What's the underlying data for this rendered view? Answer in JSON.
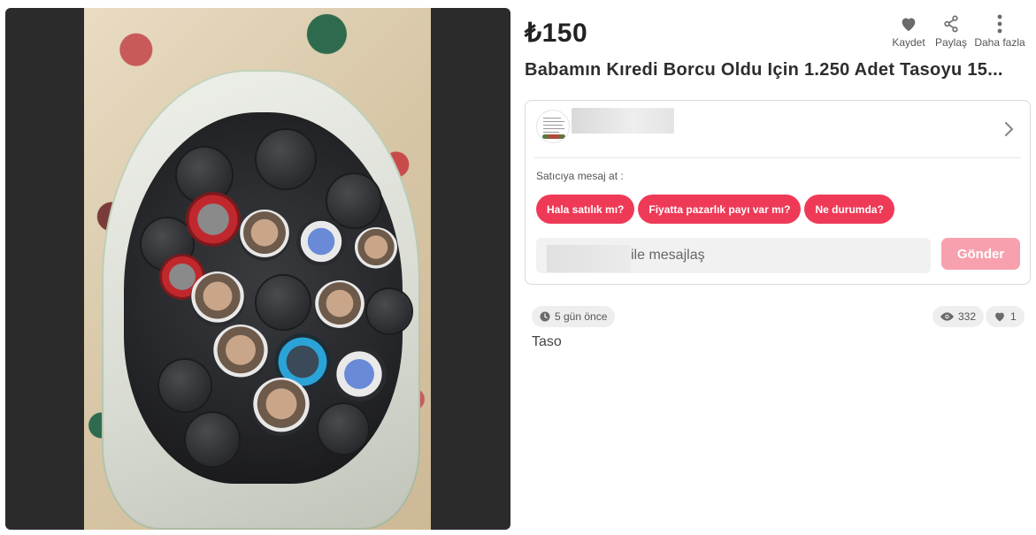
{
  "listing": {
    "price": "₺150",
    "title": "Babamın Kıredi Borcu Oldu Için 1.250 Adet Tasoyu 15...",
    "category": "Taso"
  },
  "actions": [
    {
      "label": "Kaydet",
      "icon": "heart-icon"
    },
    {
      "label": "Paylaş",
      "icon": "share-icon"
    },
    {
      "label": "Daha fazla",
      "icon": "more-vertical-icon"
    }
  ],
  "seller": {
    "message_label": "Satıcıya mesaj at :",
    "quick_messages": [
      "Hala satılık mı?",
      "Fiyatta pazarlık payı var mı?",
      "Ne durumda?"
    ],
    "input_suffix": "ile mesajlaş",
    "send_label": "Gönder"
  },
  "stats": {
    "posted": "5 gün önce",
    "views": "332",
    "likes": "1"
  },
  "colors": {
    "accent": "#ef3a57",
    "accent_disabled": "#f7a1ae"
  }
}
